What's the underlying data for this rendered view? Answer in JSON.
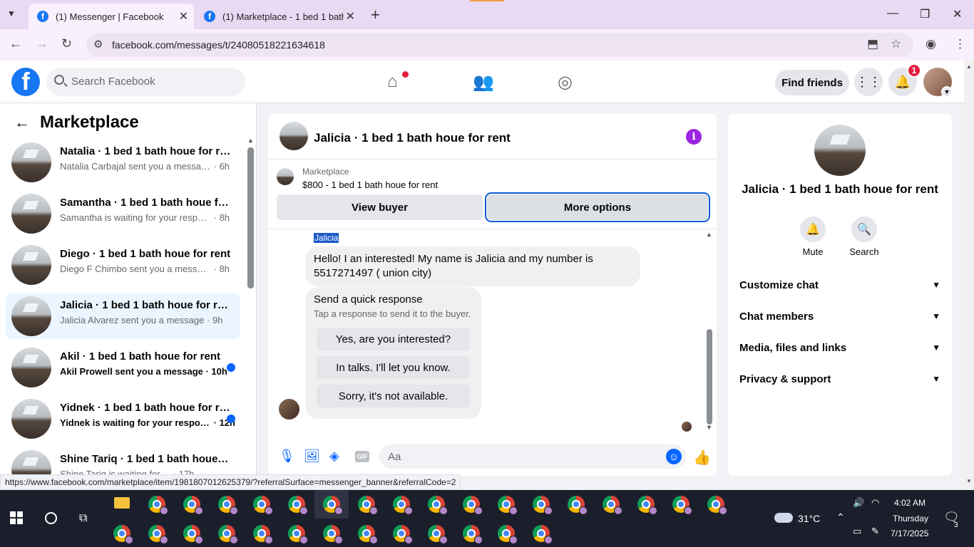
{
  "browser": {
    "tabs": [
      {
        "title": "(1) Messenger | Facebook",
        "active": true
      },
      {
        "title": "(1) Marketplace - 1 bed 1 bath h",
        "active": false
      }
    ],
    "url": "facebook.com/messages/t/24080518221634618",
    "status_url": "https://www.facebook.com/marketplace/item/1981807012625379/?referralSurface=messenger_banner&referralCode=2"
  },
  "header": {
    "search_placeholder": "Search Facebook",
    "find_friends": "Find friends",
    "notification_count": "1"
  },
  "left": {
    "title": "Marketplace",
    "conversations": [
      {
        "name": "Natalia · 1 bed 1 bath houe for rent",
        "preview": "Natalia Carbajal sent you a message",
        "time": "· 6h",
        "unread": false
      },
      {
        "name": "Samantha · 1 bed 1 bath houe for rent",
        "preview": "Samantha is waiting for your response",
        "time": "· 8h",
        "unread": false
      },
      {
        "name": "Diego · 1 bed 1 bath houe for rent",
        "preview": "Diego F Chimbo sent you a message",
        "time": "· 8h",
        "unread": false
      },
      {
        "name": "Jalicia · 1 bed 1 bath houe for rent",
        "preview": "Jalicia Alvarez sent you a message",
        "time": "· 9h",
        "unread": false
      },
      {
        "name": "Akil · 1 bed 1 bath houe for rent",
        "preview": "Akil Prowell sent you a message",
        "time": "· 10h",
        "unread": true
      },
      {
        "name": "Yidnek · 1 bed 1 bath houe for rent",
        "preview": "Yidnek is waiting for your response",
        "time": "· 12h",
        "unread": true
      },
      {
        "name": "Shine Tariq · 1 bed 1 bath houe for rent",
        "preview": "Shine Tariq is waiting for ...",
        "time": "· 17h",
        "unread": false
      }
    ]
  },
  "chat": {
    "title": "Jalicia · 1 bed 1 bath houe for rent",
    "marketplace_label": "Marketplace",
    "listing": "$800 - 1 bed 1 bath houe for rent",
    "view_buyer": "View buyer",
    "more_options": "More options",
    "sender": "Jalicia",
    "message": "Hello! I an interested! My name is Jalicia and my number is 5517271497 ( union city)",
    "quick_title": "Send a quick response",
    "quick_subtitle": "Tap a response to send it to the buyer.",
    "quick_replies": [
      "Yes, are you interested?",
      "In talks. I'll let you know.",
      "Sorry, it's not available."
    ],
    "composer_placeholder": "Aa"
  },
  "right": {
    "title": "Jalicia · 1 bed 1 bath houe for rent",
    "actions": [
      "Mute",
      "Search"
    ],
    "sections": [
      "Customize chat",
      "Chat members",
      "Media, files and links",
      "Privacy & support"
    ]
  },
  "taskbar": {
    "temperature": "31°C",
    "time": "4:02 AM",
    "day": "Thursday",
    "date": "7/17/2025",
    "notifications": "3"
  },
  "colors": {
    "facebook_blue": "#1877f2",
    "messenger_blue": "#0866ff",
    "info_purple": "#9b25e0",
    "badge_red": "#e41e3f"
  }
}
